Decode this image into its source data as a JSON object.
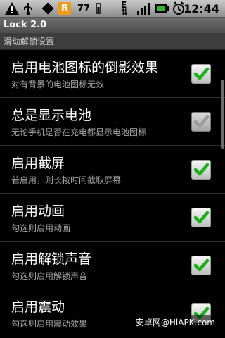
{
  "status_bar": {
    "battery_text": "77",
    "time": "12:44",
    "icons": [
      "warning-icon",
      "usb-icon",
      "r-app-icon",
      "battery-level-icon",
      "network-e-icon",
      "signal-icon",
      "charging-icon",
      "alarm-icon"
    ]
  },
  "app": {
    "title": "Lock 2.0"
  },
  "section_header": "滑动解锁设置",
  "items": [
    {
      "title": "启用电池图标的倒影效果",
      "subtitle": "对有背景的电池图标无效",
      "checked": true,
      "enabled": true
    },
    {
      "title": "总是显示电池",
      "subtitle": "无论手机是否在充电都显示电池图标",
      "checked": true,
      "enabled": false
    },
    {
      "title": "启用截屏",
      "subtitle": "若启用，则长按时间截取屏幕",
      "checked": true,
      "enabled": true
    },
    {
      "title": "启用动画",
      "subtitle": "勾选则启用动画",
      "checked": true,
      "enabled": true
    },
    {
      "title": "启用解锁声音",
      "subtitle": "勾选则启用解锁声音",
      "checked": true,
      "enabled": true
    },
    {
      "title": "启用震动",
      "subtitle": "勾选则启用震动效果",
      "checked": true,
      "enabled": true
    }
  ],
  "watermark": "安卓网@HiAPK.com"
}
